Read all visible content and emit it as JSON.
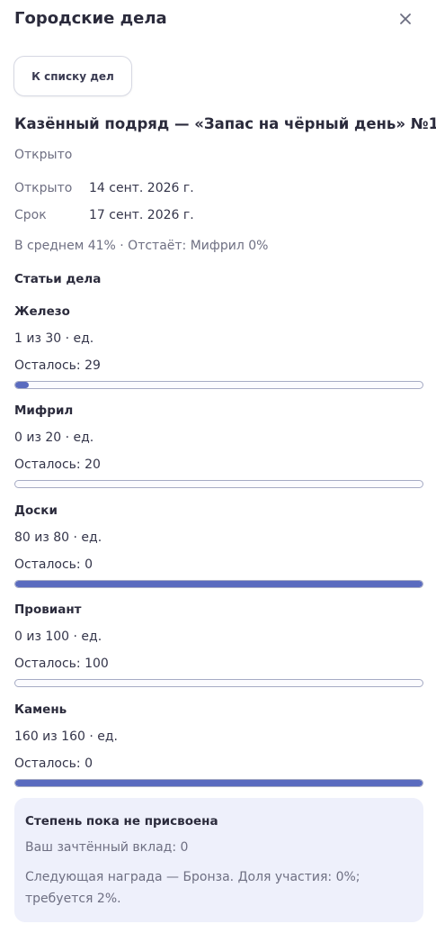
{
  "header": {
    "title": "Городские дела"
  },
  "back_button": {
    "label": "К списку дел"
  },
  "job": {
    "title": "Казённый подряд — «Запас на чёрный день» №1",
    "status": "Открыто",
    "opened_label": "Открыто",
    "opened_value": "14 сент. 2026 г.",
    "deadline_label": "Срок",
    "deadline_value": "17 сент. 2026 г.",
    "summary": "В среднем 41% · Отстаёт: Мифрил 0%"
  },
  "items_heading": "Статьи дела",
  "items": [
    {
      "name": "Железо",
      "qty": "1 из 30 · ед.",
      "remaining": "Осталось: 29",
      "progress": 0.033
    },
    {
      "name": "Мифрил",
      "qty": "0 из 20 · ед.",
      "remaining": "Осталось: 20",
      "progress": 0
    },
    {
      "name": "Доски",
      "qty": "80 из 80 · ед.",
      "remaining": "Осталось: 0",
      "progress": 1
    },
    {
      "name": "Провиант",
      "qty": "0 из 100 · ед.",
      "remaining": "Осталось: 100",
      "progress": 0
    },
    {
      "name": "Камень",
      "qty": "160 из 160 · ед.",
      "remaining": "Осталось: 0",
      "progress": 1
    }
  ],
  "reward": {
    "title": "Степень пока не присвоена",
    "contribution": "Ваш зачтённый вклад: 0",
    "next": "Следующая награда — Бронза. Доля участия: 0%; требуется 2%."
  },
  "colors": {
    "accent": "#5a6bbf",
    "card_bg": "#eef0fb",
    "bar_border": "#a6abc4"
  },
  "icons": {
    "close": "close-icon"
  }
}
